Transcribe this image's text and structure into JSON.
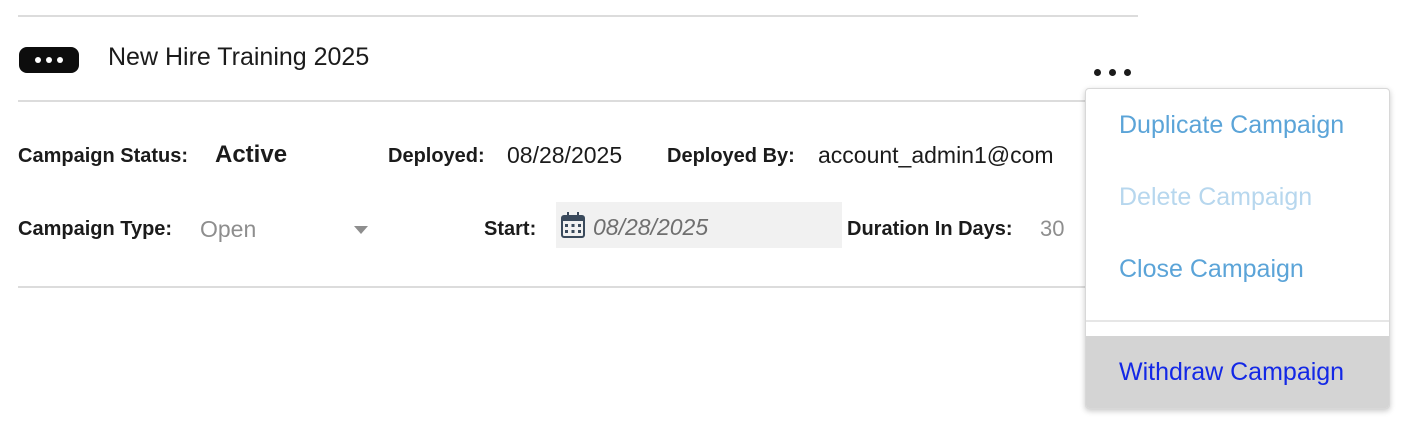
{
  "campaign": {
    "name": "New Hire Training 2025"
  },
  "details": {
    "status_label": "Campaign Status:",
    "status_value": "Active",
    "deployed_label": "Deployed:",
    "deployed_value": "08/28/2025",
    "deployed_by_label": "Deployed By:",
    "deployed_by_value": "account_admin1@com",
    "type_label": "Campaign Type:",
    "type_value": "Open",
    "start_label": "Start:",
    "start_value": "08/28/2025",
    "duration_label": "Duration In Days:",
    "duration_value": "30"
  },
  "icons": {
    "badge": "more-dots-badge-icon",
    "calendar": "calendar-icon",
    "caret": "caret-down-icon",
    "menu_trigger": "more-horizontal-icon"
  },
  "menu": {
    "items": [
      {
        "label": "Duplicate Campaign",
        "enabled": true
      },
      {
        "label": "Delete Campaign",
        "enabled": false
      },
      {
        "label": "Close Campaign",
        "enabled": true
      },
      {
        "label": "Withdraw Campaign",
        "enabled": true,
        "hovered": true
      }
    ]
  },
  "colors": {
    "menu_link": "#5ba4d8",
    "menu_disabled": "#b7d7ee",
    "menu_hover_bg": "#d4d4d4",
    "menu_hover_text": "#1328e6",
    "muted_text": "#8e8e8e"
  }
}
